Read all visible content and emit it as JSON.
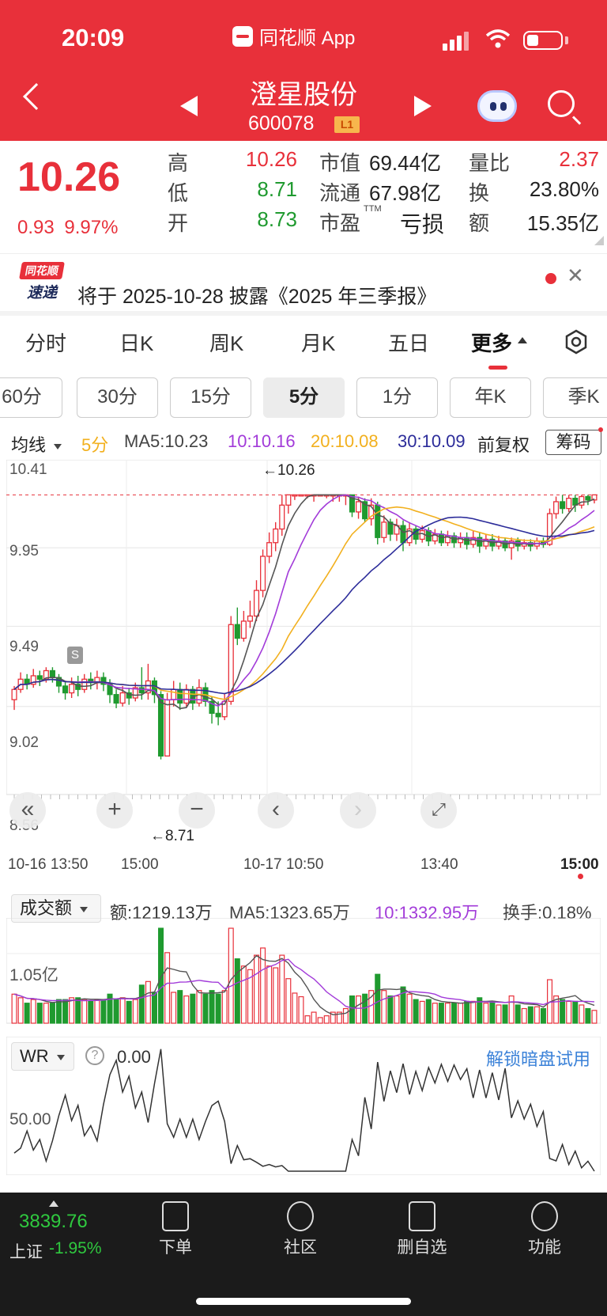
{
  "status": {
    "time": "20:09",
    "app": "同花顺 App"
  },
  "header": {
    "name": "澄星股份",
    "code": "600078",
    "badge": "L1"
  },
  "quote": {
    "price": "10.26",
    "change": "0.93",
    "change_pct": "9.97%",
    "high_label": "高",
    "high": "10.26",
    "low_label": "低",
    "low": "8.71",
    "open_label": "开",
    "open": "8.73",
    "mcap_label": "市值",
    "mcap": "69.44亿",
    "float_label": "流通",
    "float": "67.98亿",
    "pe_label": "市盈",
    "pe_sup": "TTM",
    "pe": "亏损",
    "vr_label": "量比",
    "vr": "2.37",
    "turn_label": "换",
    "turn": "23.80%",
    "amt_label": "额",
    "amt": "15.35亿"
  },
  "banner": {
    "logo_top": "同花顺",
    "logo_bottom": "速递",
    "text": "将于 2025-10-28 披露《2025 年三季报》"
  },
  "tabs": [
    "分时",
    "日K",
    "周K",
    "月K",
    "五日",
    "更多"
  ],
  "periods": [
    "60分",
    "30分",
    "15分",
    "5分",
    "1分",
    "年K",
    "季K"
  ],
  "ma_row": {
    "dropdown": "均线",
    "period": "5分",
    "ma5": "MA5:10.23",
    "ma10": "10:10.16",
    "ma20": "20:10.08",
    "ma30": "30:10.09",
    "fq": "前复权",
    "chips": "筹码"
  },
  "kline": {
    "y_labels": [
      "10.41",
      "9.95",
      "9.49",
      "9.02",
      "8.56"
    ],
    "x_labels": [
      "10-16 13:50",
      "15:00",
      "10-17 10:50",
      "13:40",
      "15:00"
    ],
    "high_marker": "←10.26",
    "low_marker": "←8.71",
    "s_marker": "S"
  },
  "volume": {
    "dropdown": "成交额",
    "amount": "额:1219.13万",
    "ma5": "MA5:1323.65万",
    "ma10": "10:1332.95万",
    "turnover": "换手:0.18%",
    "y_label": "1.05亿"
  },
  "wr": {
    "dropdown": "WR",
    "help": "?",
    "value": "0.00",
    "unlock": "解锁暗盘试用",
    "y_label": "50.00"
  },
  "bottom": {
    "index_value": "3839.76",
    "index_name": "上证",
    "index_change": "-1.95%",
    "nav": [
      "下单",
      "社区",
      "删自选",
      "功能"
    ]
  },
  "colors": {
    "up": "#e8303a",
    "down": "#1f9a2f",
    "ma5": "#555555",
    "ma10": "#a23bd9",
    "ma20": "#f2b01e",
    "ma30": "#2c2c9a"
  },
  "chart_data": {
    "type": "candlestick",
    "interval": "5分",
    "ylim": [
      8.56,
      10.41
    ],
    "candles": [
      [
        9.06,
        9.12,
        9.0,
        9.14
      ],
      [
        9.12,
        9.18,
        9.1,
        9.22
      ],
      [
        9.18,
        9.15,
        9.12,
        9.21
      ],
      [
        9.15,
        9.2,
        9.13,
        9.24
      ],
      [
        9.2,
        9.18,
        9.14,
        9.23
      ],
      [
        9.18,
        9.23,
        9.16,
        9.25
      ],
      [
        9.23,
        9.19,
        9.16,
        9.25
      ],
      [
        9.19,
        9.14,
        9.1,
        9.21
      ],
      [
        9.14,
        9.1,
        9.06,
        9.17
      ],
      [
        9.1,
        9.15,
        9.07,
        9.19
      ],
      [
        9.15,
        9.12,
        9.08,
        9.2
      ],
      [
        9.12,
        9.18,
        9.1,
        9.21
      ],
      [
        9.18,
        9.16,
        9.12,
        9.22
      ],
      [
        9.16,
        9.19,
        9.12,
        9.23
      ],
      [
        9.19,
        9.15,
        9.11,
        9.22
      ],
      [
        9.15,
        9.09,
        9.04,
        9.18
      ],
      [
        9.09,
        9.04,
        9.01,
        9.12
      ],
      [
        9.04,
        9.1,
        9.02,
        9.14
      ],
      [
        9.1,
        9.07,
        9.03,
        9.13
      ],
      [
        9.07,
        9.13,
        9.05,
        9.16
      ],
      [
        9.13,
        9.1,
        9.06,
        9.25
      ],
      [
        9.1,
        9.17,
        9.06,
        9.27
      ],
      [
        9.17,
        9.09,
        9.04,
        9.19
      ],
      [
        9.09,
        8.73,
        8.71,
        9.11
      ],
      [
        8.73,
        9.06,
        8.73,
        9.1
      ],
      [
        9.06,
        9.12,
        9.02,
        9.17
      ],
      [
        9.12,
        9.04,
        9.0,
        9.16
      ],
      [
        9.04,
        9.12,
        9.02,
        9.15
      ],
      [
        9.12,
        9.04,
        9.0,
        9.14
      ],
      [
        9.04,
        9.13,
        9.02,
        9.18
      ],
      [
        9.13,
        9.05,
        9.02,
        9.16
      ],
      [
        9.05,
        8.98,
        8.92,
        9.08
      ],
      [
        8.98,
        8.96,
        8.91,
        9.05
      ],
      [
        8.96,
        9.05,
        8.94,
        9.1
      ],
      [
        9.05,
        9.5,
        9.03,
        9.55
      ],
      [
        9.5,
        9.42,
        9.38,
        9.6
      ],
      [
        9.42,
        9.52,
        9.4,
        9.58
      ],
      [
        9.52,
        9.55,
        9.48,
        9.64
      ],
      [
        9.55,
        9.7,
        9.52,
        9.76
      ],
      [
        9.7,
        9.9,
        9.66,
        9.94
      ],
      [
        9.9,
        9.98,
        9.86,
        10.04
      ],
      [
        9.98,
        10.06,
        9.93,
        10.1
      ],
      [
        10.06,
        10.2,
        10.02,
        10.26
      ],
      [
        10.2,
        10.26,
        10.15,
        10.26
      ],
      [
        10.26,
        10.26,
        10.23,
        10.26
      ],
      [
        10.26,
        10.26,
        10.25,
        10.26
      ],
      [
        10.26,
        10.26,
        10.24,
        10.26
      ],
      [
        10.26,
        10.26,
        10.22,
        10.26
      ],
      [
        10.26,
        10.26,
        10.25,
        10.26
      ],
      [
        10.26,
        10.26,
        10.24,
        10.26
      ],
      [
        10.26,
        10.26,
        10.22,
        10.26
      ],
      [
        10.26,
        10.26,
        10.22,
        10.26
      ],
      [
        10.26,
        10.26,
        10.2,
        10.26
      ],
      [
        10.26,
        10.16,
        10.13,
        10.26
      ],
      [
        10.16,
        10.22,
        10.12,
        10.25
      ],
      [
        10.22,
        10.12,
        10.1,
        10.24
      ],
      [
        10.12,
        10.2,
        10.08,
        10.24
      ],
      [
        10.2,
        10.01,
        9.97,
        10.22
      ],
      [
        10.01,
        10.1,
        9.98,
        10.14
      ],
      [
        10.1,
        10.03,
        9.99,
        10.12
      ],
      [
        10.03,
        10.08,
        9.99,
        10.12
      ],
      [
        10.08,
        9.98,
        9.93,
        10.11
      ],
      [
        9.98,
        10.06,
        9.96,
        10.1
      ],
      [
        10.06,
        10.0,
        9.97,
        10.08
      ],
      [
        10.0,
        10.05,
        9.98,
        10.08
      ],
      [
        10.05,
        9.99,
        9.96,
        10.07
      ],
      [
        9.99,
        10.03,
        9.97,
        10.06
      ],
      [
        10.03,
        9.98,
        9.96,
        10.05
      ],
      [
        9.98,
        10.02,
        9.96,
        10.05
      ],
      [
        10.02,
        9.98,
        9.95,
        10.04
      ],
      [
        9.98,
        10.01,
        9.95,
        10.04
      ],
      [
        10.01,
        9.97,
        9.94,
        10.04
      ],
      [
        9.97,
        10.01,
        9.95,
        10.05
      ],
      [
        10.01,
        9.96,
        9.92,
        10.04
      ],
      [
        9.96,
        10.0,
        9.94,
        10.03
      ],
      [
        10.0,
        9.96,
        9.93,
        10.03
      ],
      [
        9.96,
        9.99,
        9.94,
        10.02
      ],
      [
        9.99,
        9.95,
        9.93,
        10.01
      ],
      [
        9.95,
        9.99,
        9.88,
        10.01
      ],
      [
        9.99,
        9.96,
        9.93,
        10.01
      ],
      [
        9.96,
        9.98,
        9.94,
        10.0
      ],
      [
        9.98,
        9.96,
        9.93,
        10.0
      ],
      [
        9.96,
        9.99,
        9.94,
        10.01
      ],
      [
        9.99,
        9.97,
        9.95,
        10.01
      ],
      [
        9.97,
        10.15,
        9.96,
        10.18
      ],
      [
        10.15,
        10.22,
        10.12,
        10.25
      ],
      [
        10.22,
        10.18,
        10.15,
        10.26
      ],
      [
        10.18,
        10.24,
        10.16,
        10.26
      ],
      [
        10.24,
        10.2,
        10.16,
        10.26
      ],
      [
        10.2,
        10.25,
        10.18,
        10.26
      ],
      [
        10.25,
        10.23,
        10.2,
        10.26
      ],
      [
        10.23,
        10.26,
        10.21,
        10.26
      ]
    ],
    "candle_format": "[open, close, low, high]"
  }
}
